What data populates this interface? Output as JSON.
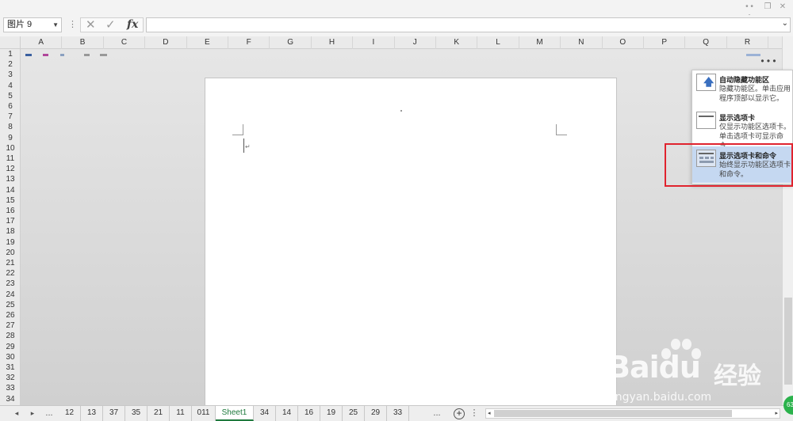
{
  "window": {
    "more_glyph": "• • •",
    "restore_glyph": "❐",
    "close_glyph": "✕"
  },
  "formula_bar": {
    "name_box_value": "图片 9",
    "dropdown_glyph": "▼",
    "sep_glyph": "⋮",
    "cancel_glyph": "✕",
    "confirm_glyph": "✓",
    "fx_label": "fx",
    "formula_value": "",
    "expand_glyph": "⌄"
  },
  "columns": [
    "A",
    "B",
    "C",
    "D",
    "E",
    "F",
    "G",
    "H",
    "I",
    "J",
    "K",
    "L",
    "M",
    "N",
    "O",
    "P",
    "Q",
    "R"
  ],
  "rows": [
    "1",
    "2",
    "3",
    "4",
    "5",
    "6",
    "7",
    "8",
    "9",
    "10",
    "11",
    "12",
    "13",
    "14",
    "15",
    "16",
    "17",
    "18",
    "19",
    "20",
    "21",
    "22",
    "23",
    "24",
    "25",
    "26",
    "27",
    "28",
    "29",
    "30",
    "31",
    "32",
    "33",
    "34"
  ],
  "document": {
    "paragraph_mark": "↵"
  },
  "ribbon_menu": {
    "more_glyph": "• • •",
    "items": [
      {
        "title": "自动隐藏功能区",
        "desc": "隐藏功能区。单击应用程序顶部以显示它。",
        "icon": "auto-hide-ribbon-icon",
        "selected": false
      },
      {
        "title": "显示选项卡",
        "desc": "仅显示功能区选项卡。单击选项卡可显示命令。",
        "icon": "show-tabs-icon",
        "selected": false
      },
      {
        "title": "显示选项卡和命令",
        "desc": "始终显示功能区选项卡和命令。",
        "icon": "show-tabs-and-commands-icon",
        "selected": true
      }
    ],
    "arrow_glyph": "🡅"
  },
  "tabbar": {
    "nav_prev": "◂",
    "nav_next": "▸",
    "ellipsis_left": "...",
    "ellipsis_right": "...",
    "add_glyph": "+",
    "options_glyph": "⋮",
    "tabs": [
      "12",
      "13",
      "37",
      "35",
      "21",
      "11",
      "011",
      "Sheet1",
      "34",
      "14",
      "16",
      "19",
      "25",
      "29",
      "33"
    ],
    "active_tab": "Sheet1",
    "hscroll_left": "◂",
    "hscroll_right": "▸"
  },
  "watermark": {
    "logo_text": "Baidu",
    "brand_text": "经验",
    "url": "jingyan.baidu.com"
  },
  "badge": {
    "value": "63"
  },
  "colors": {
    "accent_green": "#1f7a3d",
    "highlight_red": "#e0232e",
    "selection_blue": "#c5d8f1"
  }
}
